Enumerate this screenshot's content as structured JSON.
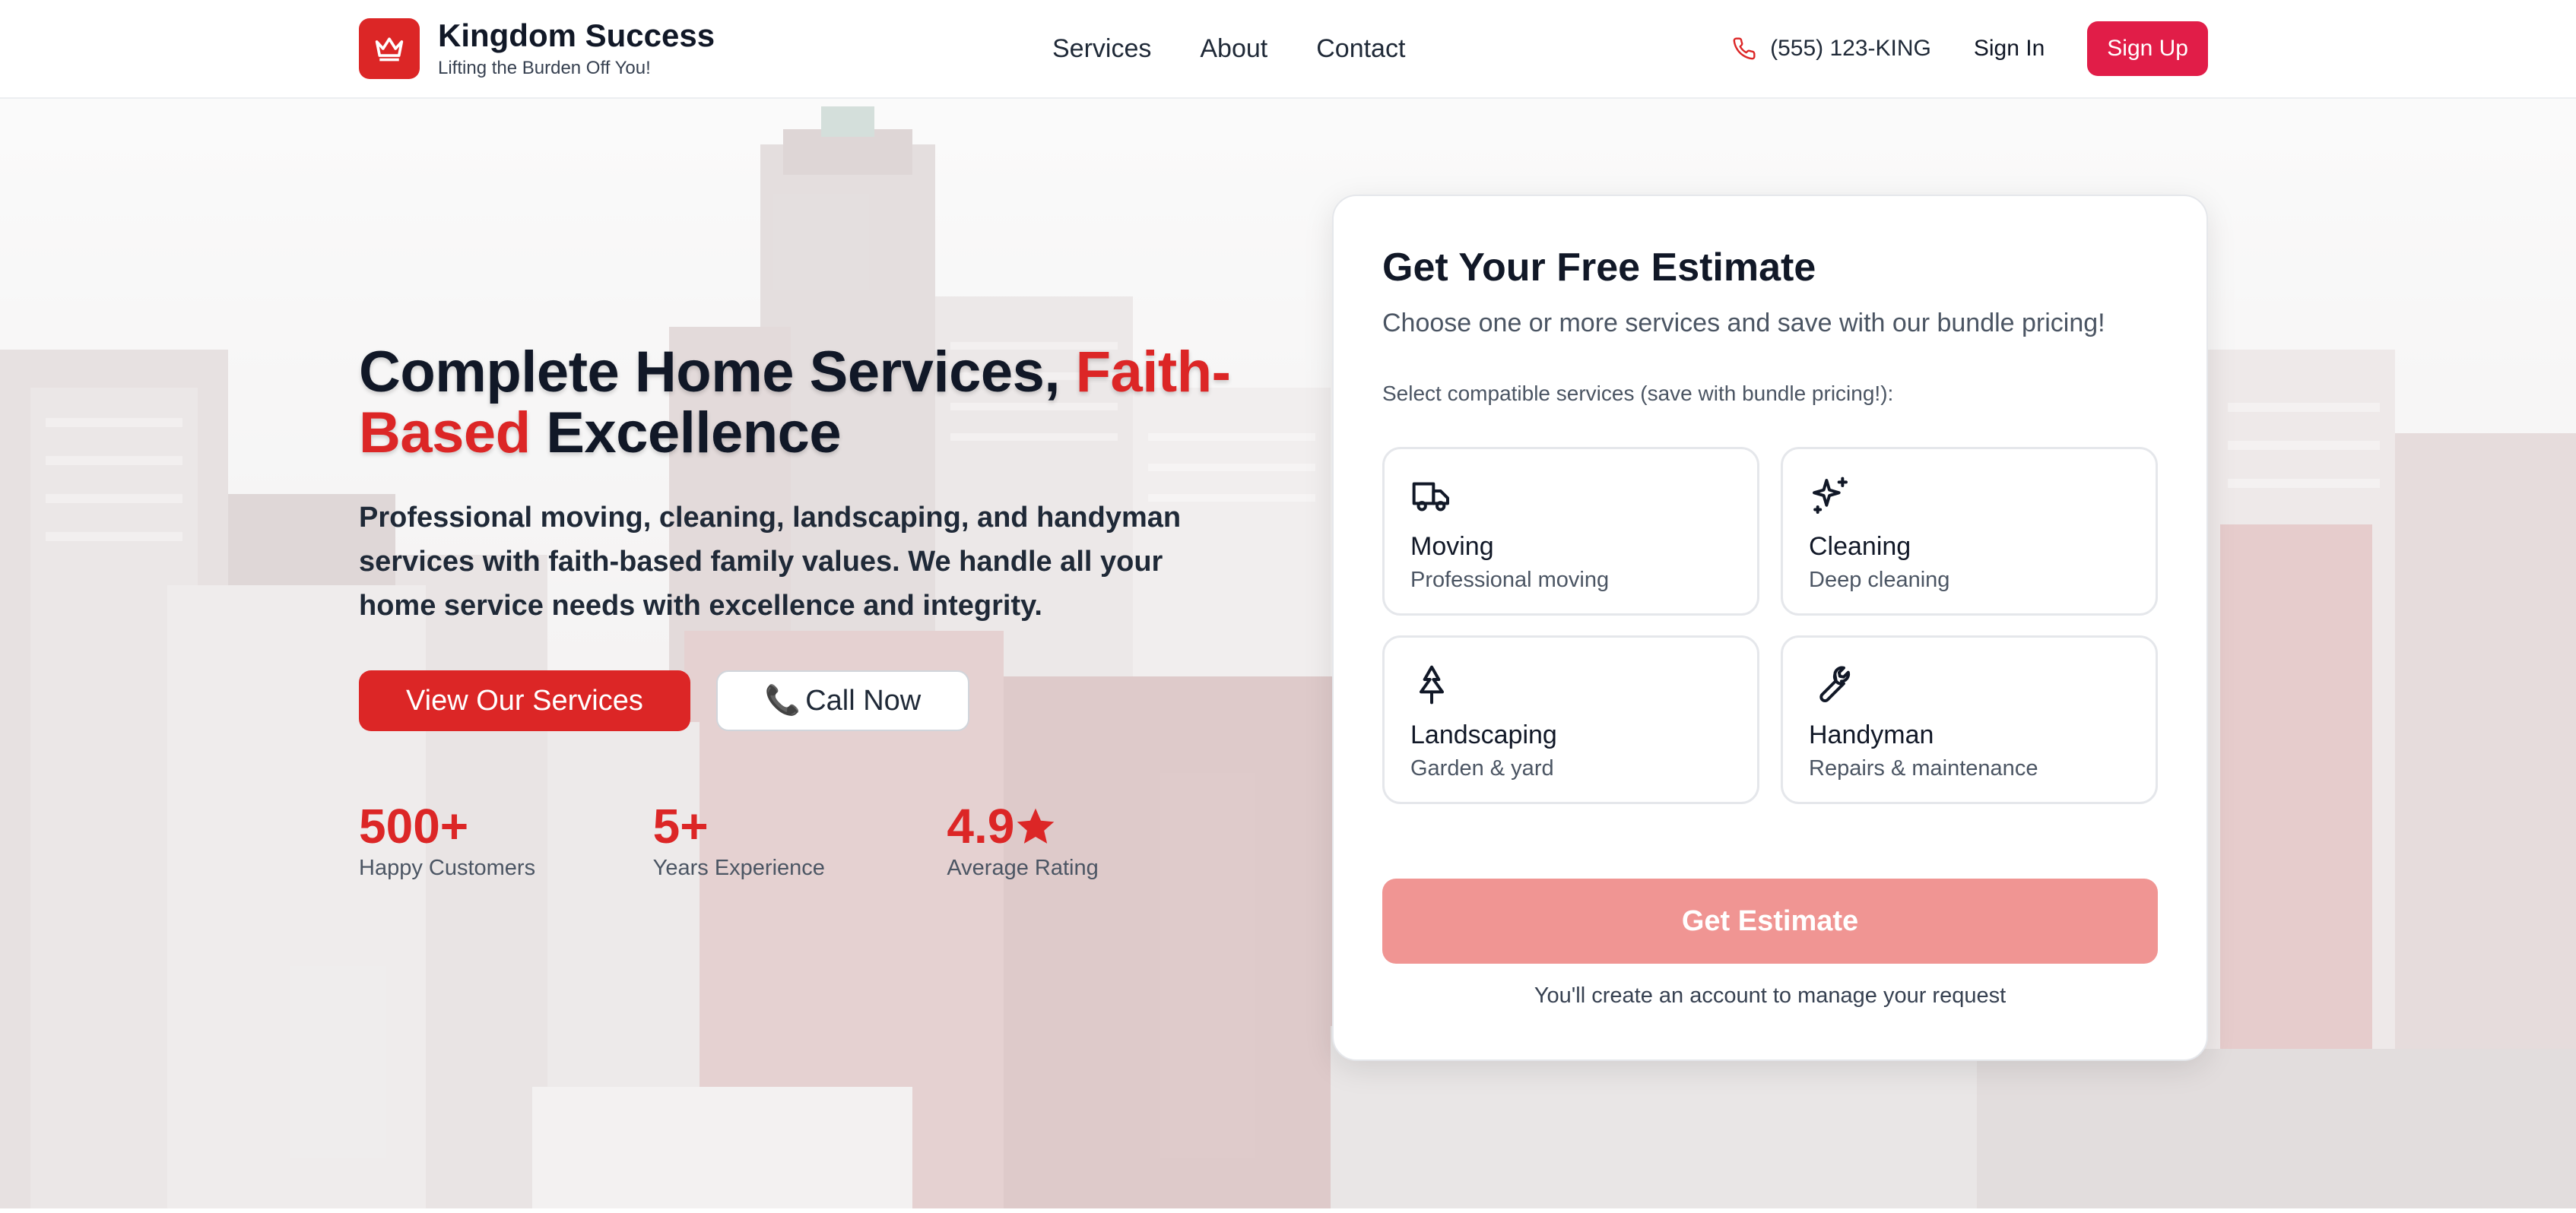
{
  "header": {
    "brand_name": "Kingdom Success",
    "brand_tagline": "Lifting the Burden Off You!",
    "logo_icon": "crown-icon",
    "nav": [
      {
        "label": "Services"
      },
      {
        "label": "About"
      },
      {
        "label": "Contact"
      }
    ],
    "phone": "(555) 123-KING",
    "phone_icon": "phone-icon",
    "sign_in": "Sign In",
    "sign_up": "Sign Up"
  },
  "hero": {
    "title_part1": "Complete Home Services, ",
    "title_accent": "Faith-Based",
    "title_part2": " Excellence",
    "description": "Professional moving, cleaning, landscaping, and handyman services with faith-based family values. We handle all your home service needs with excellence and integrity.",
    "primary_button": "View Our Services",
    "secondary_button": "Call Now",
    "secondary_icon": "phone-emoji-icon",
    "stats": [
      {
        "value": "500+",
        "label": "Happy Customers"
      },
      {
        "value": "5+",
        "label": "Years Experience"
      },
      {
        "value": "4.9",
        "label": "Average Rating",
        "icon": "star-icon"
      }
    ]
  },
  "estimate": {
    "title": "Get Your Free Estimate",
    "subtitle": "Choose one or more services and save with our bundle pricing!",
    "hint": "Select compatible services (save with bundle pricing!):",
    "services": [
      {
        "name": "Moving",
        "desc": "Professional moving",
        "icon": "truck-icon"
      },
      {
        "name": "Cleaning",
        "desc": "Deep cleaning",
        "icon": "sparkles-icon"
      },
      {
        "name": "Landscaping",
        "desc": "Garden & yard",
        "icon": "tree-icon"
      },
      {
        "name": "Handyman",
        "desc": "Repairs & maintenance",
        "icon": "wrench-icon"
      }
    ],
    "button": "Get Estimate",
    "footnote": "You'll create an account to manage your request"
  },
  "colors": {
    "brand_red": "#dc2626",
    "signup_rose": "#e11d48",
    "disabled_button": "#f09593"
  }
}
